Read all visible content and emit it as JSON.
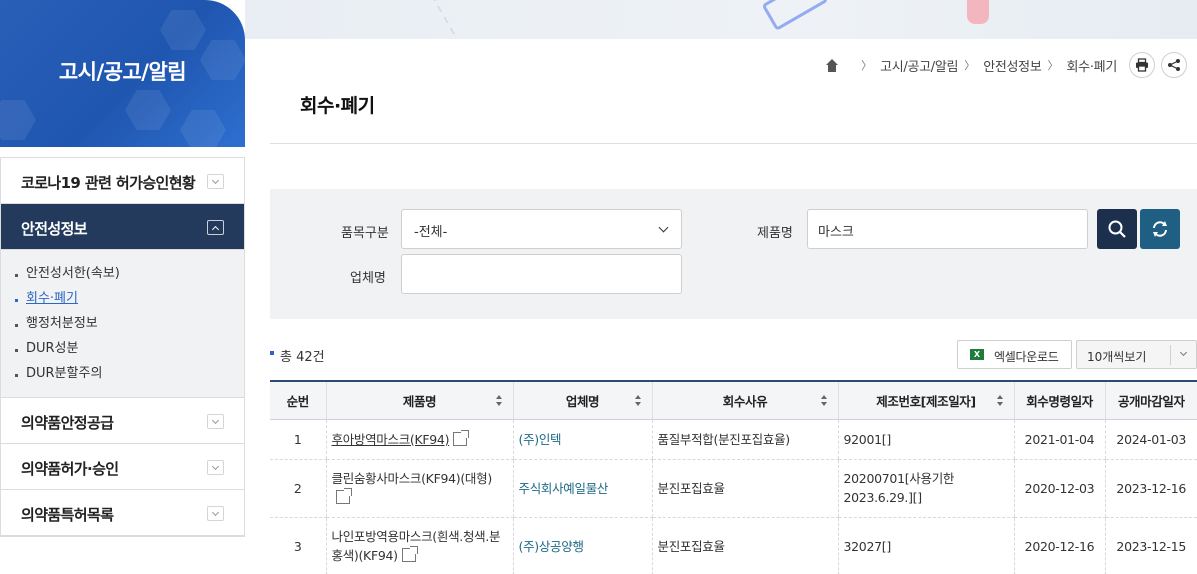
{
  "sidebar": {
    "section_title": "고시/공고/알림",
    "menu": [
      {
        "label": "코로나19 관련 허가승인현황",
        "active": false
      },
      {
        "label": "안전성정보",
        "active": true
      }
    ],
    "sub_items": [
      "안전성서한(속보)",
      "회수·폐기",
      "행정처분정보",
      "DUR성분",
      "DUR분할주의"
    ],
    "current_sub": "회수·폐기",
    "menu_after": [
      {
        "label": "의약품안정공급"
      },
      {
        "label": "의약품허가·승인"
      },
      {
        "label": "의약품특허목록"
      }
    ]
  },
  "breadcrumb": {
    "items": [
      "고시/공고/알림",
      "안전성정보",
      "회수·폐기"
    ],
    "print_icon": "print-icon",
    "share_icon": "share-icon"
  },
  "page_title": "회수·폐기",
  "search": {
    "category_label": "품목구분",
    "category_value": "-전체-",
    "product_label": "제품명",
    "product_value": "마스크",
    "company_label": "업체명",
    "company_value": "",
    "search_icon": "search-icon",
    "reset_icon": "refresh-icon"
  },
  "results": {
    "total_text": "총 42건",
    "excel_label": "엑셀다운로드",
    "page_size_label": "10개씩보기"
  },
  "table": {
    "headers": [
      "순번",
      "제품명",
      "업체명",
      "회수사유",
      "제조번호[제조일자]",
      "회수명령일자",
      "공개마감일자"
    ],
    "rows": [
      {
        "no": "1",
        "product": "후아방역마스크(KF94)",
        "company": "(주)인텍",
        "reason": "품질부적합(분진포집효율)",
        "lot": "92001[]",
        "order_date": "2021-01-04",
        "close_date": "2024-01-03"
      },
      {
        "no": "2",
        "product": "클린숨황사마스크(KF94)(대형)",
        "company": "주식회사예일물산",
        "reason": "분진포집효율",
        "lot": "20200701[사용기한 2023.6.29.][]",
        "order_date": "2020-12-03",
        "close_date": "2023-12-16"
      },
      {
        "no": "3",
        "product": "나인포방역용마스크(흰색.청색.분홍색)(KF94)",
        "company": "(주)상공양행",
        "reason": "분진포집효율",
        "lot": "32027[]",
        "order_date": "2020-12-16",
        "close_date": "2023-12-15"
      }
    ]
  },
  "colors": {
    "brand_blue": "#1f56b0",
    "active_menu": "#233a5c",
    "table_border": "#2e4a74",
    "search_button": "#1c2f4d",
    "reset_button": "#1f5f84",
    "company_link": "#1d6a86"
  }
}
